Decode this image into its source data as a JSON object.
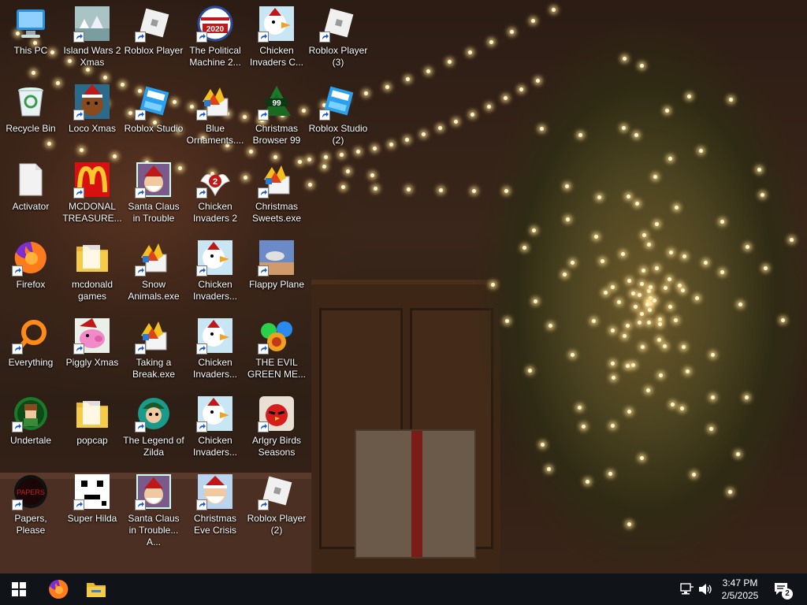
{
  "desktop": {
    "icons": [
      {
        "label": "This PC",
        "icon": "this-pc-icon",
        "shortcut": false
      },
      {
        "label": "Island Wars 2 Xmas",
        "icon": "island-wars-icon",
        "shortcut": true
      },
      {
        "label": "Roblox Player",
        "icon": "roblox-player-icon",
        "shortcut": true
      },
      {
        "label": "The Political Machine 2...",
        "icon": "political-machine-icon",
        "shortcut": true
      },
      {
        "label": "Chicken Invaders C...",
        "icon": "chicken-invaders-icon",
        "shortcut": true
      },
      {
        "label": "Roblox Player (3)",
        "icon": "roblox-player-icon",
        "shortcut": true
      },
      {
        "label": "Recycle Bin",
        "icon": "recycle-bin-icon",
        "shortcut": false
      },
      {
        "label": "Loco Xmas",
        "icon": "loco-xmas-icon",
        "shortcut": true
      },
      {
        "label": "Roblox Studio",
        "icon": "roblox-studio-icon",
        "shortcut": true
      },
      {
        "label": "Blue Ornaments....",
        "icon": "exe-game-icon",
        "shortcut": true
      },
      {
        "label": "Christmas Browser 99",
        "icon": "christmas-browser-icon",
        "shortcut": true
      },
      {
        "label": "Roblox Studio (2)",
        "icon": "roblox-studio-icon",
        "shortcut": true
      },
      {
        "label": "Activator",
        "icon": "file-icon",
        "shortcut": false
      },
      {
        "label": "MCDONAL TREASURE...",
        "icon": "mcdonalds-icon",
        "shortcut": true
      },
      {
        "label": "Santa Claus in Trouble",
        "icon": "santa-trouble-icon",
        "shortcut": true
      },
      {
        "label": "Chicken Invaders 2",
        "icon": "chicken-invaders-2-icon",
        "shortcut": true
      },
      {
        "label": "Christmas Sweets.exe",
        "icon": "exe-game-icon",
        "shortcut": true
      },
      {
        "label": "Firefox",
        "icon": "firefox-icon",
        "shortcut": true
      },
      {
        "label": "mcdonald games",
        "icon": "folder-icon",
        "shortcut": false
      },
      {
        "label": "Snow Animals.exe",
        "icon": "exe-game-icon",
        "shortcut": true
      },
      {
        "label": "Chicken Invaders...",
        "icon": "chicken-invaders-icon",
        "shortcut": true
      },
      {
        "label": "Flappy Plane",
        "icon": "flappy-plane-icon",
        "shortcut": true
      },
      {
        "label": "Everything",
        "icon": "everything-search-icon",
        "shortcut": true
      },
      {
        "label": "Piggly Xmas",
        "icon": "piggly-xmas-icon",
        "shortcut": true
      },
      {
        "label": "Taking a Break.exe",
        "icon": "exe-game-icon",
        "shortcut": true
      },
      {
        "label": "Chicken Invaders...",
        "icon": "chicken-invaders-icon",
        "shortcut": true
      },
      {
        "label": "THE EVIL GREEN ME...",
        "icon": "evil-green-icon",
        "shortcut": true
      },
      {
        "label": "Undertale",
        "icon": "undertale-icon",
        "shortcut": true
      },
      {
        "label": "popcap",
        "icon": "folder-icon",
        "shortcut": false
      },
      {
        "label": "The Legend of Zilda",
        "icon": "legend-zilda-icon",
        "shortcut": true
      },
      {
        "label": "Chicken Invaders...",
        "icon": "chicken-invaders-icon",
        "shortcut": true
      },
      {
        "label": "Arlgry Birds Seasons",
        "icon": "angry-birds-icon",
        "shortcut": true
      },
      {
        "label": "Papers, Please",
        "icon": "papers-please-icon",
        "shortcut": true
      },
      {
        "label": "Super Hilda",
        "icon": "super-hilda-icon",
        "shortcut": true
      },
      {
        "label": "Santa Claus in Trouble... A...",
        "icon": "santa-trouble-icon",
        "shortcut": true
      },
      {
        "label": "Christmas Eve Crisis",
        "icon": "christmas-eve-crisis-icon",
        "shortcut": true
      },
      {
        "label": "Roblox Player (2)",
        "icon": "roblox-player-icon",
        "shortcut": true
      }
    ]
  },
  "taskbar": {
    "clock": {
      "time": "3:47 PM",
      "date": "2/5/2025"
    },
    "notifications": {
      "count": "2"
    }
  }
}
